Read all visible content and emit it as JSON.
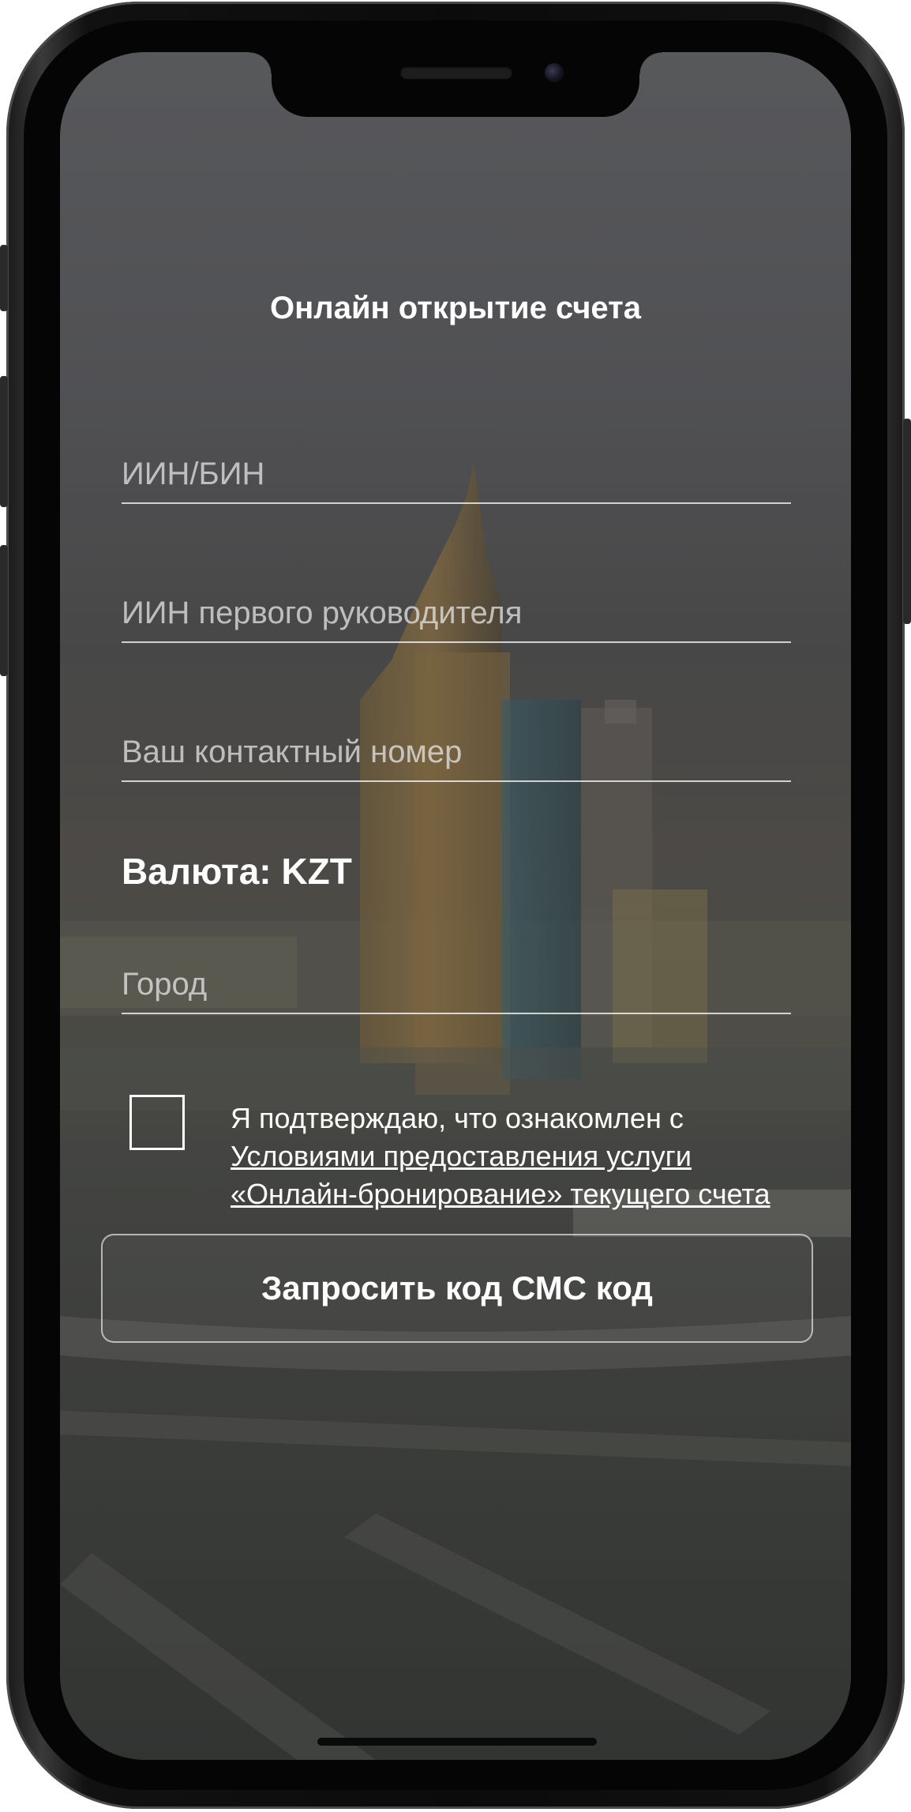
{
  "screen": {
    "title": "Онлайн открытие счета"
  },
  "form": {
    "iin_bin_placeholder": "ИИН/БИН",
    "iin_bin_value": "",
    "director_iin_placeholder": "ИИН первого руководителя",
    "director_iin_value": "",
    "phone_placeholder": "Ваш контактный номер",
    "phone_value": "",
    "currency_label": "Валюта: KZT",
    "city_placeholder": "Город",
    "city_value": ""
  },
  "consent": {
    "checked": false,
    "text_prefix": "Я подтверждаю, что ознакомлен с",
    "link_text": "Условиями предоставления услуги «Онлайн-бронирование» текущего счета"
  },
  "actions": {
    "request_sms_label": "Запросить код СМС код"
  },
  "colors": {
    "text": "#ffffff",
    "overlay": "#46464a",
    "frame": "#0b0b0b"
  }
}
